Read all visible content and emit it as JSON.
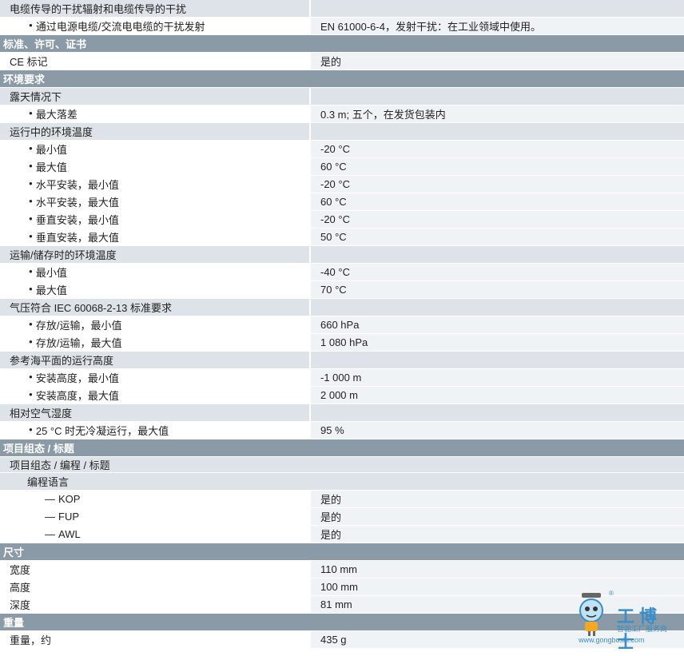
{
  "rows": [
    {
      "kind": "sub",
      "label": "电缆传导的干扰辐射和电缆传导的干扰",
      "value": ""
    },
    {
      "kind": "item",
      "indent": 1,
      "bullet": true,
      "label": "通过电源电缆/交流电电缆的干扰发射",
      "value": "EN 61000-6-4，发射干扰：在工业领域中使用。"
    },
    {
      "kind": "section",
      "label": "标准、许可、证书"
    },
    {
      "kind": "item",
      "indent": 0,
      "bullet": false,
      "label": "CE 标记",
      "value": "是的"
    },
    {
      "kind": "section",
      "label": "环境要求"
    },
    {
      "kind": "sub",
      "label": "露天情况下",
      "value": ""
    },
    {
      "kind": "item",
      "indent": 1,
      "bullet": true,
      "label": "最大落差",
      "value": "0.3 m; 五个，在发货包装内"
    },
    {
      "kind": "sub",
      "label": "运行中的环境温度",
      "value": ""
    },
    {
      "kind": "item",
      "indent": 1,
      "bullet": true,
      "label": "最小值",
      "value": "-20 °C"
    },
    {
      "kind": "item",
      "indent": 1,
      "bullet": true,
      "label": "最大值",
      "value": "60 °C"
    },
    {
      "kind": "item",
      "indent": 1,
      "bullet": true,
      "label": "水平安装，最小值",
      "value": "-20 °C"
    },
    {
      "kind": "item",
      "indent": 1,
      "bullet": true,
      "label": "水平安装，最大值",
      "value": "60 °C"
    },
    {
      "kind": "item",
      "indent": 1,
      "bullet": true,
      "label": "垂直安装，最小值",
      "value": "-20 °C"
    },
    {
      "kind": "item",
      "indent": 1,
      "bullet": true,
      "label": "垂直安装，最大值",
      "value": "50 °C"
    },
    {
      "kind": "sub",
      "label": "运输/储存时的环境温度",
      "value": ""
    },
    {
      "kind": "item",
      "indent": 1,
      "bullet": true,
      "label": "最小值",
      "value": "-40 °C"
    },
    {
      "kind": "item",
      "indent": 1,
      "bullet": true,
      "label": "最大值",
      "value": "70 °C"
    },
    {
      "kind": "sub",
      "label": "气压符合 IEC 60068-2-13 标准要求",
      "value": ""
    },
    {
      "kind": "item",
      "indent": 1,
      "bullet": true,
      "label": "存放/运输，最小值",
      "value": "660 hPa"
    },
    {
      "kind": "item",
      "indent": 1,
      "bullet": true,
      "label": "存放/运输，最大值",
      "value": "1 080 hPa"
    },
    {
      "kind": "sub",
      "label": "参考海平面的运行高度",
      "value": ""
    },
    {
      "kind": "item",
      "indent": 1,
      "bullet": true,
      "label": "安装高度，最小值",
      "value": "-1 000 m"
    },
    {
      "kind": "item",
      "indent": 1,
      "bullet": true,
      "label": "安装高度，最大值",
      "value": "2 000 m"
    },
    {
      "kind": "sub",
      "label": "相对空气湿度",
      "value": ""
    },
    {
      "kind": "item",
      "indent": 1,
      "bullet": true,
      "label": "25 °C 时无冷凝运行，最大值",
      "value": "95 %"
    },
    {
      "kind": "section",
      "label": "项目组态 / 标题"
    },
    {
      "kind": "sub2",
      "label": "项目组态 / 编程 / 标题"
    },
    {
      "kind": "sub3",
      "label": "编程语言"
    },
    {
      "kind": "item",
      "indent": 2,
      "dash": true,
      "label": "KOP",
      "value": "是的"
    },
    {
      "kind": "item",
      "indent": 2,
      "dash": true,
      "label": "FUP",
      "value": "是的"
    },
    {
      "kind": "item",
      "indent": 2,
      "dash": true,
      "label": "AWL",
      "value": "是的"
    },
    {
      "kind": "section",
      "label": "尺寸"
    },
    {
      "kind": "item",
      "indent": 0,
      "bullet": false,
      "label": "宽度",
      "value": "110 mm"
    },
    {
      "kind": "item",
      "indent": 0,
      "bullet": false,
      "label": "高度",
      "value": "100 mm"
    },
    {
      "kind": "item",
      "indent": 0,
      "bullet": false,
      "label": "深度",
      "value": "81 mm"
    },
    {
      "kind": "section",
      "label": "重量"
    },
    {
      "kind": "item",
      "indent": 0,
      "bullet": false,
      "label": "重量，约",
      "value": "435 g"
    }
  ],
  "logo": {
    "name": "工博士",
    "tagline": "智能工厂服务商",
    "url": "www.gongboshi.com",
    "reg": "®"
  }
}
